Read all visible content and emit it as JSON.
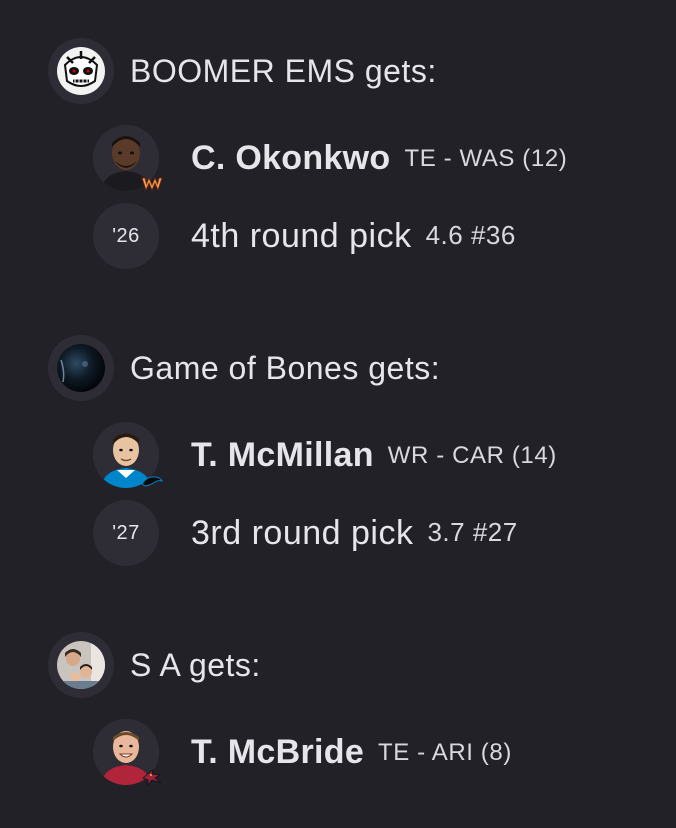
{
  "trade": {
    "sides": [
      {
        "team_name": "BOOMER EMS gets:",
        "avatar_icon": "skull-mascot-icon",
        "assets": [
          {
            "kind": "player",
            "name": "C. Okonkwo",
            "meta": "TE - WAS (12)",
            "team_logo_icon": "commanders-w-icon",
            "team_color": "#b5651d"
          },
          {
            "kind": "pick",
            "year": "'26",
            "label": "4th round pick",
            "meta": "4.6 #36"
          }
        ]
      },
      {
        "team_name": "Game of Bones gets:",
        "avatar_icon": "dark-globe-icon",
        "assets": [
          {
            "kind": "player",
            "name": "T. McMillan",
            "meta": "WR - CAR (14)",
            "team_logo_icon": "panthers-icon",
            "team_color": "#0085ca"
          },
          {
            "kind": "pick",
            "year": "'27",
            "label": "3rd round pick",
            "meta": "3.7 #27"
          }
        ]
      },
      {
        "team_name": "S A gets:",
        "avatar_icon": "family-photo-icon",
        "assets": [
          {
            "kind": "player",
            "name": "T. McBride",
            "meta": "TE - ARI (8)",
            "team_logo_icon": "cardinals-icon",
            "team_color": "#97233f"
          }
        ]
      }
    ]
  }
}
